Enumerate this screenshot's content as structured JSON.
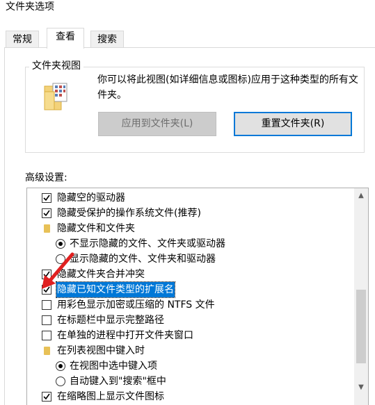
{
  "window": {
    "title": "文件夹选项"
  },
  "tabs": [
    {
      "label": "常规",
      "active": false
    },
    {
      "label": "查看",
      "active": true
    },
    {
      "label": "搜索",
      "active": false
    }
  ],
  "folder_view": {
    "group_label": "文件夹视图",
    "description": "你可以将此视图(如详细信息或图标)应用于这种类型的所有文件夹。",
    "apply_button": "应用到文件夹(L)",
    "reset_button": "重置文件夹(R)"
  },
  "advanced": {
    "label": "高级设置:",
    "items": [
      {
        "type": "checkbox",
        "checked": true,
        "indent": 1,
        "label": "隐藏空的驱动器"
      },
      {
        "type": "checkbox",
        "checked": true,
        "indent": 1,
        "label": "隐藏受保护的操作系统文件(推荐)"
      },
      {
        "type": "folder",
        "indent": 1,
        "label": "隐藏文件和文件夹"
      },
      {
        "type": "radio",
        "checked": true,
        "indent": 2,
        "label": "不显示隐藏的文件、文件夹或驱动器"
      },
      {
        "type": "radio",
        "checked": false,
        "indent": 2,
        "label": "显示隐藏的文件、文件夹和驱动器"
      },
      {
        "type": "checkbox",
        "checked": true,
        "indent": 1,
        "label": "隐藏文件夹合并冲突"
      },
      {
        "type": "checkbox",
        "checked": true,
        "indent": 1,
        "label": "隐藏已知文件类型的扩展名",
        "selected": true
      },
      {
        "type": "checkbox",
        "checked": false,
        "indent": 1,
        "label": "用彩色显示加密或压缩的 NTFS 文件"
      },
      {
        "type": "checkbox",
        "checked": false,
        "indent": 1,
        "label": "在标题栏中显示完整路径"
      },
      {
        "type": "checkbox",
        "checked": false,
        "indent": 1,
        "label": "在单独的进程中打开文件夹窗口"
      },
      {
        "type": "folder",
        "indent": 1,
        "label": "在列表视图中键入时"
      },
      {
        "type": "radio",
        "checked": true,
        "indent": 2,
        "label": "在视图中选中键入项"
      },
      {
        "type": "radio",
        "checked": false,
        "indent": 2,
        "label": "自动键入到\"搜索\"框中"
      },
      {
        "type": "checkbox",
        "checked": true,
        "indent": 1,
        "label": "在缩略图上显示文件图标"
      }
    ]
  },
  "colors": {
    "selection": "#0078d7",
    "annotation_arrow": "#e02020",
    "folder": "#e8c157"
  }
}
